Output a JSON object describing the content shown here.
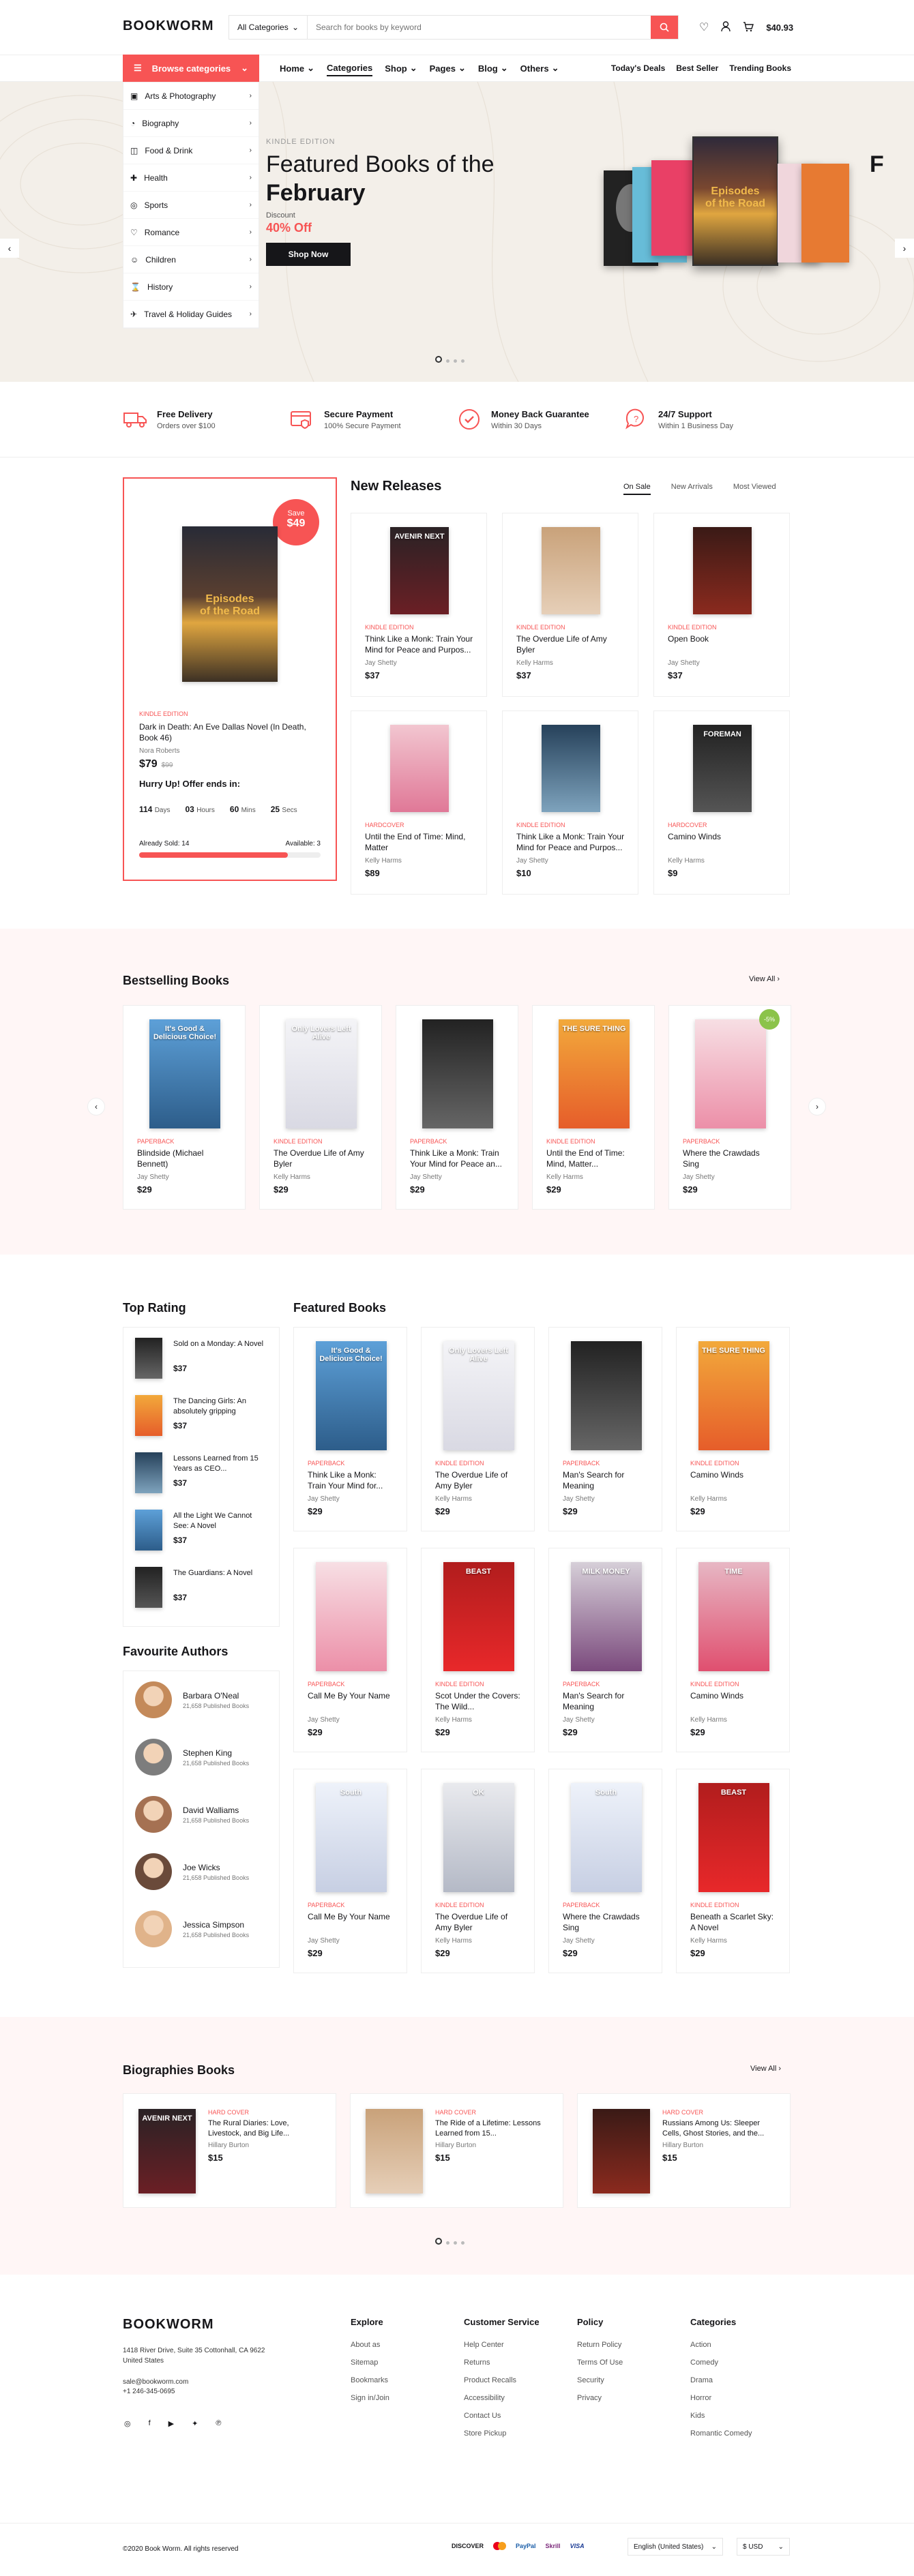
{
  "brand": "BOOKWORM",
  "search": {
    "category": "All Categories",
    "placeholder": "Search for books by keyword"
  },
  "header": {
    "cart_total": "$40.93"
  },
  "nav": {
    "browse": "Browse categories",
    "menu": [
      "Home",
      "Categories",
      "Shop",
      "Pages",
      "Blog",
      "Others"
    ],
    "right": [
      "Today's Deals",
      "Best Seller",
      "Trending Books"
    ]
  },
  "categories": [
    "Arts & Photography",
    "Biography",
    "Food & Drink",
    "Health",
    "Sports",
    "Romance",
    "Children",
    "History",
    "Travel & Holiday Guides"
  ],
  "hero": {
    "kicker": "KINDLE EDITION",
    "title1": "Featured Books of the",
    "title2": "February",
    "discount_label": "Discount",
    "discount": "40% Off",
    "button": "Shop Now",
    "preview_letter": "F"
  },
  "features": [
    {
      "title": "Free Delivery",
      "sub": "Orders over $100"
    },
    {
      "title": "Secure Payment",
      "sub": "100% Secure Payment"
    },
    {
      "title": "Money Back Guarantee",
      "sub": "Within 30 Days"
    },
    {
      "title": "24/7 Support",
      "sub": "Within 1 Business Day"
    }
  ],
  "deal": {
    "badge_label": "Save",
    "badge_value": "$49",
    "format": "KINDLE EDITION",
    "title": "Dark in Death: An Eve Dallas Novel (In Death, Book 46)",
    "author": "Nora Roberts",
    "price": "$79",
    "old_price": "$99",
    "offer": "Hurry Up! Offer ends in:",
    "countdown": [
      {
        "v": "114",
        "l": "Days"
      },
      {
        "v": "03",
        "l": "Hours"
      },
      {
        "v": "60",
        "l": "Mins"
      },
      {
        "v": "25",
        "l": "Secs"
      }
    ],
    "sold": "Already Sold: 14",
    "available": "Available: 3",
    "progress": 0.82
  },
  "new_releases": {
    "title": "New Releases",
    "tabs": [
      "On Sale",
      "New Arrivals",
      "Most Viewed"
    ],
    "items": [
      {
        "format": "KINDLE EDITION",
        "title": "Think Like a Monk: Train Your Mind for Peace and Purpos...",
        "author": "Jay Shetty",
        "price": "$37"
      },
      {
        "format": "KINDLE EDITION",
        "title": "The Overdue Life of Amy Byler",
        "author": "Kelly Harms",
        "price": "$37"
      },
      {
        "format": "KINDLE EDITION",
        "title": "Open Book",
        "author": "Jay Shetty",
        "price": "$37"
      },
      {
        "format": "HARDCOVER",
        "title": "Until the End of Time: Mind, Matter",
        "author": "Kelly Harms",
        "price": "$89"
      },
      {
        "format": "KINDLE EDITION",
        "title": "Think Like a Monk: Train Your Mind for Peace and Purpos...",
        "author": "Jay Shetty",
        "price": "$10"
      },
      {
        "format": "HARDCOVER",
        "title": "Camino Winds",
        "author": "Kelly Harms",
        "price": "$9"
      }
    ]
  },
  "bestselling": {
    "title": "Bestselling Books",
    "view_all": "View All",
    "badge": "-5%",
    "items": [
      {
        "format": "PAPERBACK",
        "title": "Blindside (Michael Bennett)",
        "author": "Jay Shetty",
        "price": "$29"
      },
      {
        "format": "KINDLE EDITION",
        "title": "The Overdue Life of Amy Byler",
        "author": "Kelly Harms",
        "price": "$29"
      },
      {
        "format": "PAPERBACK",
        "title": "Think Like a Monk: Train Your Mind for Peace an...",
        "author": "Jay Shetty",
        "price": "$29"
      },
      {
        "format": "KINDLE EDITION",
        "title": "Until the End of Time: Mind, Matter...",
        "author": "Kelly Harms",
        "price": "$29"
      },
      {
        "format": "PAPERBACK",
        "title": "Where the Crawdads Sing",
        "author": "Jay Shetty",
        "price": "$29"
      }
    ]
  },
  "top_rating": {
    "title": "Top Rating",
    "items": [
      {
        "title": "Sold on a Monday: A Novel",
        "price": "$37"
      },
      {
        "title": "The Dancing Girls: An absolutely gripping",
        "price": "$37"
      },
      {
        "title": "Lessons Learned from 15 Years as CEO...",
        "price": "$37"
      },
      {
        "title": "All the Light We Cannot See: A Novel",
        "price": "$37"
      },
      {
        "title": "The Guardians: A Novel",
        "price": "$37"
      }
    ]
  },
  "authors": {
    "title": "Favourite Authors",
    "items": [
      {
        "name": "Barbara O'Neal",
        "count": "21,658 Published Books"
      },
      {
        "name": "Stephen King",
        "count": "21,658 Published Books"
      },
      {
        "name": "David Walliams",
        "count": "21,658 Published Books"
      },
      {
        "name": "Joe Wicks",
        "count": "21,658 Published Books"
      },
      {
        "name": "Jessica Simpson",
        "count": "21,658 Published Books"
      }
    ]
  },
  "featured": {
    "title": "Featured Books",
    "items": [
      {
        "format": "PAPERBACK",
        "title": "Think Like a Monk: Train Your Mind for...",
        "author": "Jay Shetty",
        "price": "$29"
      },
      {
        "format": "KINDLE EDITION",
        "title": "The Overdue Life of Amy Byler",
        "author": "Kelly Harms",
        "price": "$29"
      },
      {
        "format": "PAPERBACK",
        "title": "Man's Search for Meaning",
        "author": "Jay Shetty",
        "price": "$29"
      },
      {
        "format": "KINDLE EDITION",
        "title": "Camino Winds",
        "author": "Kelly Harms",
        "price": "$29"
      },
      {
        "format": "PAPERBACK",
        "title": "Call Me By Your Name",
        "author": "Jay Shetty",
        "price": "$29"
      },
      {
        "format": "KINDLE EDITION",
        "title": "Scot Under the Covers: The Wild...",
        "author": "Kelly Harms",
        "price": "$29"
      },
      {
        "format": "PAPERBACK",
        "title": "Man's Search for Meaning",
        "author": "Jay Shetty",
        "price": "$29"
      },
      {
        "format": "KINDLE EDITION",
        "title": "Camino Winds",
        "author": "Kelly Harms",
        "price": "$29"
      },
      {
        "format": "PAPERBACK",
        "title": "Call Me By Your Name",
        "author": "Jay Shetty",
        "price": "$29"
      },
      {
        "format": "KINDLE EDITION",
        "title": "The Overdue Life of Amy Byler",
        "author": "Kelly Harms",
        "price": "$29"
      },
      {
        "format": "PAPERBACK",
        "title": "Where the Crawdads Sing",
        "author": "Jay Shetty",
        "price": "$29"
      },
      {
        "format": "KINDLE EDITION",
        "title": "Beneath a Scarlet Sky: A Novel",
        "author": "Kelly Harms",
        "price": "$29"
      }
    ]
  },
  "biographies": {
    "title": "Biographies Books",
    "view_all": "View All",
    "items": [
      {
        "format": "HARD COVER",
        "title": "The Rural Diaries: Love, Livestock, and Big Life...",
        "author": "Hillary Burton",
        "price": "$15"
      },
      {
        "format": "HARD COVER",
        "title": "The Ride of a Lifetime: Lessons Learned from 15...",
        "author": "Hillary Burton",
        "price": "$15"
      },
      {
        "format": "HARD COVER",
        "title": "Russians Among Us: Sleeper Cells, Ghost Stories, and the...",
        "author": "Hillary Burton",
        "price": "$15"
      }
    ]
  },
  "covers": {
    "avenir": "AVENIR NEXT",
    "camino": "FOREMAN",
    "beast": "BEAST",
    "time": "TIME",
    "milk": "MILK MONEY",
    "ok": "OK",
    "south": "South",
    "sure": "THE SURE THING",
    "good": "It's Good & Delicious Choice!",
    "tuesday": "Only Lovers Left Alive"
  },
  "footer": {
    "address": "1418 River Drive, Suite 35 Cottonhall, CA 9622 United States",
    "email": "sale@bookworm.com",
    "phone": "+1 246-345-0695",
    "cols": [
      {
        "title": "Explore",
        "links": [
          "About as",
          "Sitemap",
          "Bookmarks",
          "Sign in/Join"
        ]
      },
      {
        "title": "Customer Service",
        "links": [
          "Help Center",
          "Returns",
          "Product Recalls",
          "Accessibility",
          "Contact Us",
          "Store Pickup"
        ]
      },
      {
        "title": "Policy",
        "links": [
          "Return Policy",
          "Terms Of Use",
          "Security",
          "Privacy"
        ]
      },
      {
        "title": "Categories",
        "links": [
          "Action",
          "Comedy",
          "Drama",
          "Horror",
          "Kids",
          "Romantic Comedy"
        ]
      }
    ],
    "copyright": "©2020 Book Worm. All rights reserved",
    "payments": [
      "DISCOVER",
      "",
      "PayPal",
      "Skrill",
      "VISA"
    ],
    "language": "English (United States)",
    "currency": "$ USD"
  },
  "colors": {
    "accent": "#f75454",
    "pink_bg": "#fff6f6",
    "green": "#8bc34a"
  }
}
